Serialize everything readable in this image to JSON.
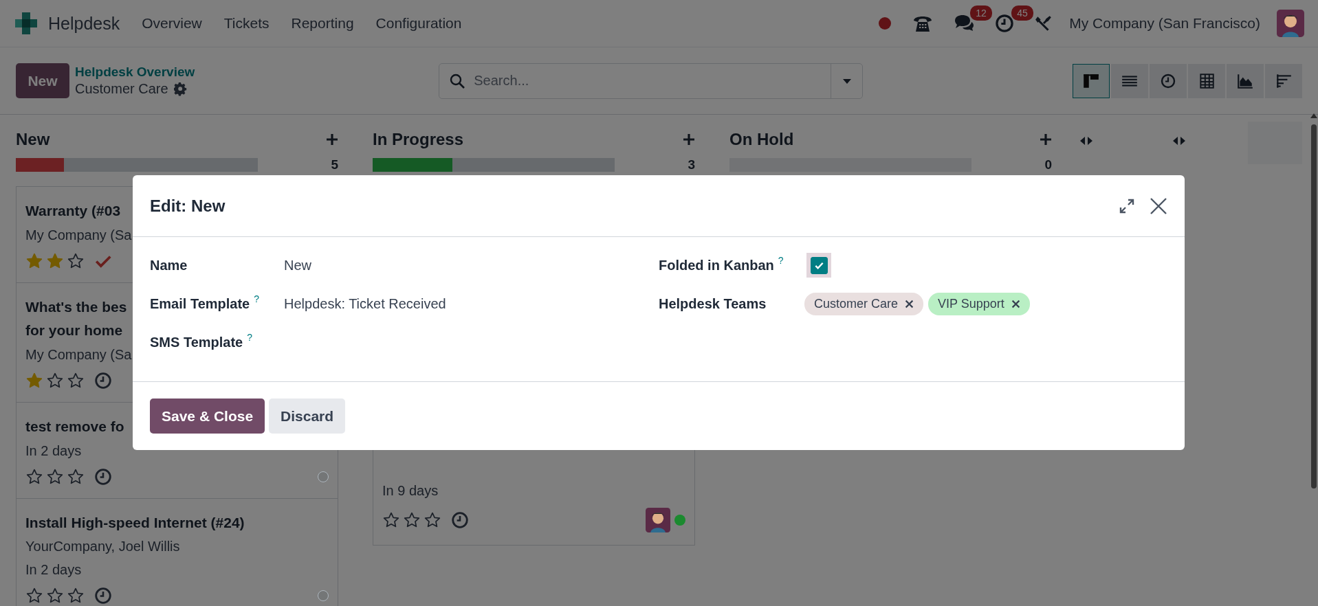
{
  "navbar": {
    "app_name": "Helpdesk",
    "menu": [
      {
        "label": "Overview"
      },
      {
        "label": "Tickets"
      },
      {
        "label": "Reporting"
      },
      {
        "label": "Configuration"
      }
    ],
    "systray": [
      {
        "kind": "status"
      },
      {
        "kind": "phone"
      },
      {
        "kind": "chat",
        "badge": "12"
      },
      {
        "kind": "activity",
        "badge": "45"
      },
      {
        "kind": "tools"
      }
    ],
    "company": "My Company (San Francisco)"
  },
  "control_panel": {
    "new_button": "New",
    "breadcrumb": "Helpdesk Overview",
    "title": "Customer Care",
    "search": {
      "placeholder": "Search..."
    },
    "views": [
      {
        "kind": "kanban",
        "selected": true
      },
      {
        "kind": "list",
        "selected": false
      },
      {
        "kind": "activity",
        "selected": false
      },
      {
        "kind": "pivot",
        "selected": false
      },
      {
        "kind": "graph",
        "selected": false
      },
      {
        "kind": "cohort",
        "selected": false
      }
    ]
  },
  "columns": [
    {
      "title": "New",
      "count": "5",
      "progress": {
        "level": 0.2,
        "color": "#6c2123"
      },
      "cards": [
        {
          "title": [
            "Warranty (#03"
          ],
          "lines": [
            "My Company (Sa"
          ],
          "stars": 2,
          "done": true
        },
        {
          "title": [
            "What's the bes",
            "for your home"
          ],
          "lines": [
            "My Company (Sa"
          ],
          "stars": 1,
          "done": false
        },
        {
          "title": [
            "test remove fo"
          ],
          "lines": [
            "In 2 days"
          ],
          "stars": 0,
          "done": false,
          "color": "#747677"
        },
        {
          "title": [
            "Install High-speed Internet (#24)"
          ],
          "lines": [
            "YourCompany, Joel Willis",
            "In 2 days"
          ],
          "stars": 0,
          "done": false,
          "color": "#747677"
        }
      ]
    },
    {
      "title": "In Progress",
      "count": "3",
      "progress": {
        "level": 0.33,
        "color": "#155a25"
      },
      "cards": [
        {
          "lines": [
            "In 9 days"
          ],
          "stars": 0,
          "done": false,
          "avatar": true,
          "color": "#1b8a2f"
        }
      ]
    },
    {
      "title": "On Hold",
      "count": "0"
    }
  ],
  "folded_columns": [
    {
      "kind": "folded"
    },
    {
      "kind": "folded"
    }
  ],
  "dialog": {
    "title": "Edit: New",
    "fields_left": [
      {
        "label": "Name",
        "value": "New"
      },
      {
        "label": "Email Template",
        "help": "?",
        "value": "Helpdesk: Ticket Received"
      },
      {
        "label": "SMS Template",
        "help": "?"
      }
    ],
    "fields_right": [
      {
        "label": "Folded in Kanban",
        "help": "?",
        "kind": "checkbox",
        "checked": true
      },
      {
        "label": "Helpdesk Teams",
        "kind": "tags",
        "tags": [
          {
            "label": "Customer Care",
            "color": "#e9dfdf"
          },
          {
            "label": "VIP Support",
            "color": "#b9efc4"
          }
        ]
      }
    ],
    "buttons": [
      {
        "label": "Save & Close",
        "kind": "primary"
      },
      {
        "label": "Discard",
        "kind": "secondary"
      }
    ]
  }
}
